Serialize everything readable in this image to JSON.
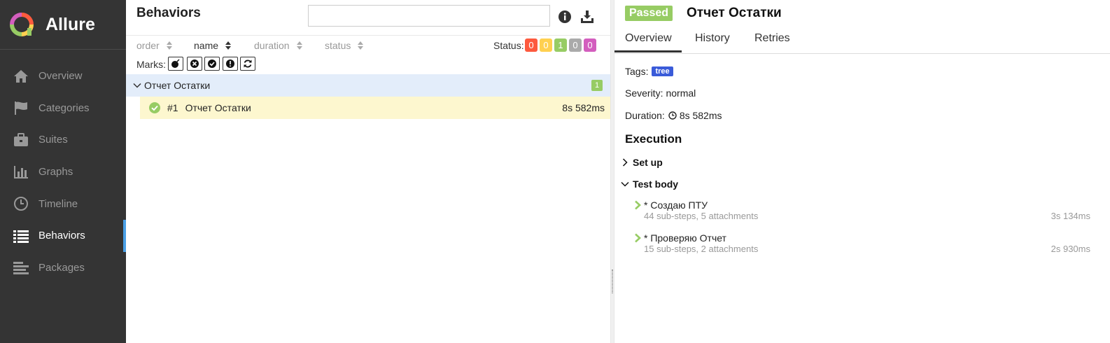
{
  "brand": {
    "name": "Allure"
  },
  "sidebar": {
    "items": [
      {
        "label": "Overview",
        "icon": "home-icon"
      },
      {
        "label": "Categories",
        "icon": "flag-icon"
      },
      {
        "label": "Suites",
        "icon": "briefcase-icon"
      },
      {
        "label": "Graphs",
        "icon": "bar-chart-icon"
      },
      {
        "label": "Timeline",
        "icon": "clock-icon"
      },
      {
        "label": "Behaviors",
        "icon": "list-icon",
        "active": true
      },
      {
        "label": "Packages",
        "icon": "align-left-icon"
      }
    ]
  },
  "behaviors": {
    "title": "Behaviors",
    "search_value": "",
    "sort": {
      "order": "order",
      "name": "name",
      "duration": "duration",
      "status": "status"
    },
    "status_label": "Status:",
    "status_counts": [
      {
        "value": "0",
        "color": "#fd5a3e"
      },
      {
        "value": "0",
        "color": "#ffd050"
      },
      {
        "value": "1",
        "color": "#97cc64"
      },
      {
        "value": "0",
        "color": "#aaaaaa"
      },
      {
        "value": "0",
        "color": "#d35ebe"
      }
    ],
    "marks_label": "Marks:",
    "marks": [
      "flaky-icon",
      "new-failed-icon",
      "new-passed-icon",
      "new-broken-icon",
      "retries-icon"
    ],
    "group": {
      "name": "Отчет Остатки",
      "count": "1"
    },
    "test": {
      "num": "#1",
      "name": "Отчет Остатки",
      "duration": "8s 582ms"
    }
  },
  "detail": {
    "status": "Passed",
    "title": "Отчет Остатки",
    "tabs": [
      "Overview",
      "History",
      "Retries"
    ],
    "tags_label": "Tags:",
    "tag": "tree",
    "severity_label": "Severity:",
    "severity": "normal",
    "duration_label": "Duration:",
    "duration": "8s 582ms",
    "execution": "Execution",
    "setup": "Set up",
    "test_body": "Test body",
    "steps": [
      {
        "name": "* Создаю ПТУ",
        "sub": "44 sub-steps, 5 attachments",
        "duration": "3s 134ms"
      },
      {
        "name": "* Проверяю Отчет",
        "sub": "15 sub-steps, 2 attachments",
        "duration": "2s 930ms"
      }
    ]
  },
  "colors": {
    "sidebar": "#343434",
    "accent": "#4ba0e6",
    "passed": "#97cc64",
    "group_bg": "#e3edfa",
    "test_bg": "#fdf7cf",
    "tag": "#3a5bd9"
  }
}
